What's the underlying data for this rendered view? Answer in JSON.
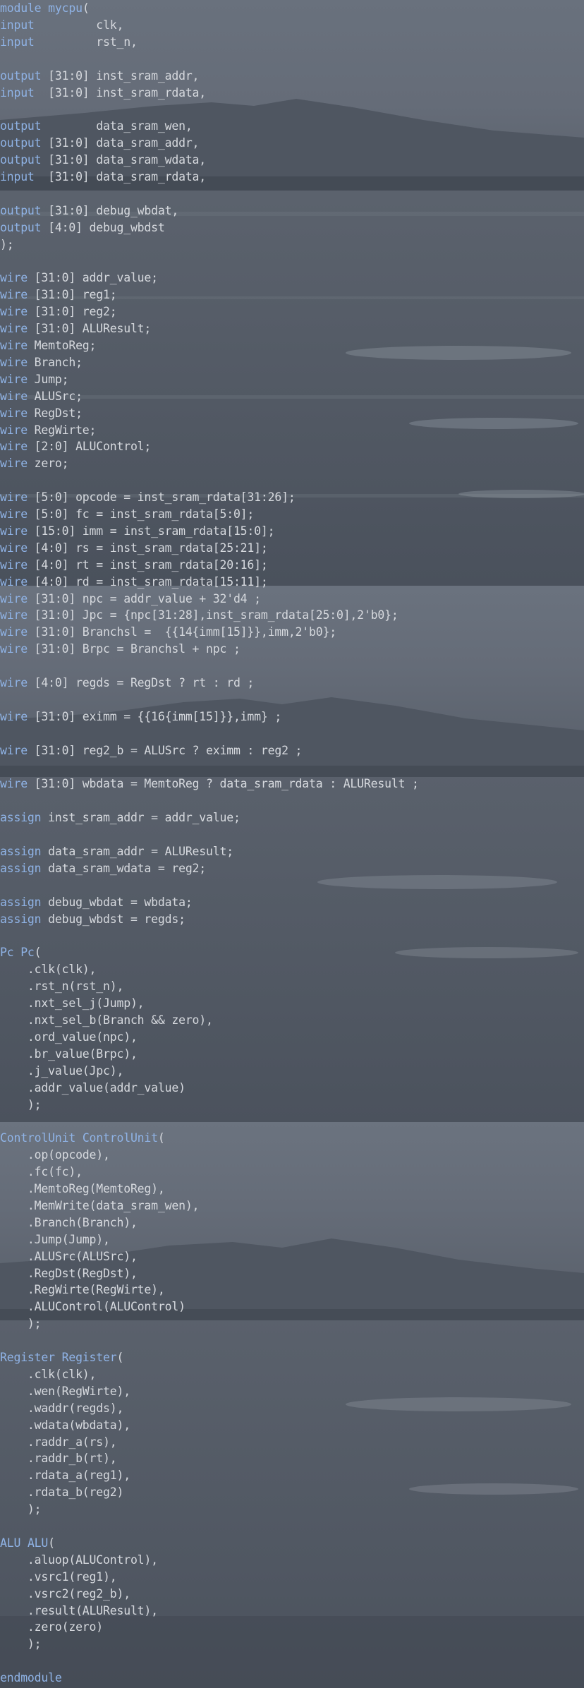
{
  "editor": {
    "colors": {
      "keyword": "#8fb3e6",
      "text": "#d6d9de",
      "background": "#59606c"
    },
    "lines": [
      {
        "row": 0,
        "tokens": [
          {
            "t": "kw",
            "v": "module"
          },
          {
            "t": "txt",
            "v": " "
          },
          {
            "t": "kw",
            "v": "mycpu"
          },
          {
            "t": "txt",
            "v": "("
          }
        ]
      },
      {
        "row": 1,
        "tokens": [
          {
            "t": "kw",
            "v": "input"
          },
          {
            "t": "txt",
            "v": "         clk,"
          }
        ]
      },
      {
        "row": 2,
        "tokens": [
          {
            "t": "kw",
            "v": "input"
          },
          {
            "t": "txt",
            "v": "         rst_n,"
          }
        ]
      },
      {
        "row": 4,
        "tokens": [
          {
            "t": "kw",
            "v": "output"
          },
          {
            "t": "txt",
            "v": " [31:0] inst_sram_addr,"
          }
        ]
      },
      {
        "row": 5,
        "tokens": [
          {
            "t": "kw",
            "v": "input"
          },
          {
            "t": "txt",
            "v": "  [31:0] inst_sram_rdata,"
          }
        ]
      },
      {
        "row": 7,
        "tokens": [
          {
            "t": "kw",
            "v": "output"
          },
          {
            "t": "txt",
            "v": "        data_sram_wen,"
          }
        ]
      },
      {
        "row": 8,
        "tokens": [
          {
            "t": "kw",
            "v": "output"
          },
          {
            "t": "txt",
            "v": " [31:0] data_sram_addr,"
          }
        ]
      },
      {
        "row": 9,
        "tokens": [
          {
            "t": "kw",
            "v": "output"
          },
          {
            "t": "txt",
            "v": " [31:0] data_sram_wdata,"
          }
        ]
      },
      {
        "row": 10,
        "tokens": [
          {
            "t": "kw",
            "v": "input"
          },
          {
            "t": "txt",
            "v": "  [31:0] data_sram_rdata,"
          }
        ]
      },
      {
        "row": 12,
        "tokens": [
          {
            "t": "kw",
            "v": "output"
          },
          {
            "t": "txt",
            "v": " [31:0] debug_wbdat,"
          }
        ]
      },
      {
        "row": 13,
        "tokens": [
          {
            "t": "kw",
            "v": "output"
          },
          {
            "t": "txt",
            "v": " [4:0] debug_wbdst"
          }
        ]
      },
      {
        "row": 14,
        "tokens": [
          {
            "t": "txt",
            "v": ");"
          }
        ]
      },
      {
        "row": 16,
        "tokens": [
          {
            "t": "kw",
            "v": "wire"
          },
          {
            "t": "txt",
            "v": " [31:0] addr_value;"
          }
        ]
      },
      {
        "row": 17,
        "tokens": [
          {
            "t": "kw",
            "v": "wire"
          },
          {
            "t": "txt",
            "v": " [31:0] reg1;"
          }
        ]
      },
      {
        "row": 18,
        "tokens": [
          {
            "t": "kw",
            "v": "wire"
          },
          {
            "t": "txt",
            "v": " [31:0] reg2;"
          }
        ]
      },
      {
        "row": 19,
        "tokens": [
          {
            "t": "kw",
            "v": "wire"
          },
          {
            "t": "txt",
            "v": " [31:0] ALUResult;"
          }
        ]
      },
      {
        "row": 20,
        "tokens": [
          {
            "t": "kw",
            "v": "wire"
          },
          {
            "t": "txt",
            "v": " MemtoReg;"
          }
        ]
      },
      {
        "row": 21,
        "tokens": [
          {
            "t": "kw",
            "v": "wire"
          },
          {
            "t": "txt",
            "v": " Branch;"
          }
        ]
      },
      {
        "row": 22,
        "tokens": [
          {
            "t": "kw",
            "v": "wire"
          },
          {
            "t": "txt",
            "v": " Jump;"
          }
        ]
      },
      {
        "row": 23,
        "tokens": [
          {
            "t": "kw",
            "v": "wire"
          },
          {
            "t": "txt",
            "v": " ALUSrc;"
          }
        ]
      },
      {
        "row": 24,
        "tokens": [
          {
            "t": "kw",
            "v": "wire"
          },
          {
            "t": "txt",
            "v": " RegDst;"
          }
        ]
      },
      {
        "row": 25,
        "tokens": [
          {
            "t": "kw",
            "v": "wire"
          },
          {
            "t": "txt",
            "v": " RegWirte;"
          }
        ]
      },
      {
        "row": 26,
        "tokens": [
          {
            "t": "kw",
            "v": "wire"
          },
          {
            "t": "txt",
            "v": " [2:0] ALUControl;"
          }
        ]
      },
      {
        "row": 27,
        "tokens": [
          {
            "t": "kw",
            "v": "wire"
          },
          {
            "t": "txt",
            "v": " zero;"
          }
        ]
      },
      {
        "row": 29,
        "tokens": [
          {
            "t": "kw",
            "v": "wire"
          },
          {
            "t": "txt",
            "v": " [5:0] opcode = inst_sram_rdata[31:26];"
          }
        ]
      },
      {
        "row": 30,
        "tokens": [
          {
            "t": "kw",
            "v": "wire"
          },
          {
            "t": "txt",
            "v": " [5:0] fc = inst_sram_rdata[5:0];"
          }
        ]
      },
      {
        "row": 31,
        "tokens": [
          {
            "t": "kw",
            "v": "wire"
          },
          {
            "t": "txt",
            "v": " [15:0] imm = inst_sram_rdata[15:0];"
          }
        ]
      },
      {
        "row": 32,
        "tokens": [
          {
            "t": "kw",
            "v": "wire"
          },
          {
            "t": "txt",
            "v": " [4:0] rs = inst_sram_rdata[25:21];"
          }
        ]
      },
      {
        "row": 33,
        "tokens": [
          {
            "t": "kw",
            "v": "wire"
          },
          {
            "t": "txt",
            "v": " [4:0] rt = inst_sram_rdata[20:16];"
          }
        ]
      },
      {
        "row": 34,
        "tokens": [
          {
            "t": "kw",
            "v": "wire"
          },
          {
            "t": "txt",
            "v": " [4:0] rd = inst_sram_rdata[15:11];"
          }
        ]
      },
      {
        "row": 35,
        "tokens": [
          {
            "t": "kw",
            "v": "wire"
          },
          {
            "t": "txt",
            "v": " [31:0] npc = addr_value + 32'd4 ;"
          }
        ]
      },
      {
        "row": 36,
        "tokens": [
          {
            "t": "kw",
            "v": "wire"
          },
          {
            "t": "txt",
            "v": " [31:0] Jpc = {npc[31:28],inst_sram_rdata[25:0],2'b0};"
          }
        ]
      },
      {
        "row": 37,
        "tokens": [
          {
            "t": "kw",
            "v": "wire"
          },
          {
            "t": "txt",
            "v": " [31:0] Branchsl =  {{14{imm[15]}},imm,2'b0};"
          }
        ]
      },
      {
        "row": 38,
        "tokens": [
          {
            "t": "kw",
            "v": "wire"
          },
          {
            "t": "txt",
            "v": " [31:0] Brpc = Branchsl + npc ;"
          }
        ]
      },
      {
        "row": 40,
        "tokens": [
          {
            "t": "kw",
            "v": "wire"
          },
          {
            "t": "txt",
            "v": " [4:0] regds = RegDst ? rt : rd ;"
          }
        ]
      },
      {
        "row": 42,
        "tokens": [
          {
            "t": "kw",
            "v": "wire"
          },
          {
            "t": "txt",
            "v": " [31:0] eximm = {{16{imm[15]}},imm} ;"
          }
        ]
      },
      {
        "row": 44,
        "tokens": [
          {
            "t": "kw",
            "v": "wire"
          },
          {
            "t": "txt",
            "v": " [31:0] reg2_b = ALUSrc ? eximm : reg2 ;"
          }
        ]
      },
      {
        "row": 46,
        "tokens": [
          {
            "t": "kw",
            "v": "wire"
          },
          {
            "t": "txt",
            "v": " [31:0] wbdata = MemtoReg ? data_sram_rdata : ALUResult ;"
          }
        ]
      },
      {
        "row": 48,
        "tokens": [
          {
            "t": "kw",
            "v": "assign"
          },
          {
            "t": "txt",
            "v": " inst_sram_addr = addr_value;"
          }
        ]
      },
      {
        "row": 50,
        "tokens": [
          {
            "t": "kw",
            "v": "assign"
          },
          {
            "t": "txt",
            "v": " data_sram_addr = ALUResult;"
          }
        ]
      },
      {
        "row": 51,
        "tokens": [
          {
            "t": "kw",
            "v": "assign"
          },
          {
            "t": "txt",
            "v": " data_sram_wdata = reg2;"
          }
        ]
      },
      {
        "row": 53,
        "tokens": [
          {
            "t": "kw",
            "v": "assign"
          },
          {
            "t": "txt",
            "v": " debug_wbdat = wbdata;"
          }
        ]
      },
      {
        "row": 54,
        "tokens": [
          {
            "t": "kw",
            "v": "assign"
          },
          {
            "t": "txt",
            "v": " debug_wbdst = regds;"
          }
        ]
      },
      {
        "row": 56,
        "tokens": [
          {
            "t": "kw",
            "v": "Pc"
          },
          {
            "t": "txt",
            "v": " "
          },
          {
            "t": "kw",
            "v": "Pc"
          },
          {
            "t": "txt",
            "v": "("
          }
        ]
      },
      {
        "row": 57,
        "tokens": [
          {
            "t": "txt",
            "v": "    .clk(clk),"
          }
        ]
      },
      {
        "row": 58,
        "tokens": [
          {
            "t": "txt",
            "v": "    .rst_n(rst_n),"
          }
        ]
      },
      {
        "row": 59,
        "tokens": [
          {
            "t": "txt",
            "v": "    .nxt_sel_j(Jump),"
          }
        ]
      },
      {
        "row": 60,
        "tokens": [
          {
            "t": "txt",
            "v": "    .nxt_sel_b(Branch && zero),"
          }
        ]
      },
      {
        "row": 61,
        "tokens": [
          {
            "t": "txt",
            "v": "    .ord_value(npc),"
          }
        ]
      },
      {
        "row": 62,
        "tokens": [
          {
            "t": "txt",
            "v": "    .br_value(Brpc),"
          }
        ]
      },
      {
        "row": 63,
        "tokens": [
          {
            "t": "txt",
            "v": "    .j_value(Jpc),"
          }
        ]
      },
      {
        "row": 64,
        "tokens": [
          {
            "t": "txt",
            "v": "    .addr_value(addr_value)"
          }
        ]
      },
      {
        "row": 65,
        "tokens": [
          {
            "t": "txt",
            "v": "    );"
          }
        ]
      },
      {
        "row": 67,
        "tokens": [
          {
            "t": "kw",
            "v": "ControlUnit"
          },
          {
            "t": "txt",
            "v": " "
          },
          {
            "t": "kw",
            "v": "ControlUnit"
          },
          {
            "t": "txt",
            "v": "("
          }
        ]
      },
      {
        "row": 68,
        "tokens": [
          {
            "t": "txt",
            "v": "    .op(opcode),"
          }
        ]
      },
      {
        "row": 69,
        "tokens": [
          {
            "t": "txt",
            "v": "    .fc(fc),"
          }
        ]
      },
      {
        "row": 70,
        "tokens": [
          {
            "t": "txt",
            "v": "    .MemtoReg(MemtoReg),"
          }
        ]
      },
      {
        "row": 71,
        "tokens": [
          {
            "t": "txt",
            "v": "    .MemWrite(data_sram_wen),"
          }
        ]
      },
      {
        "row": 72,
        "tokens": [
          {
            "t": "txt",
            "v": "    .Branch(Branch),"
          }
        ]
      },
      {
        "row": 73,
        "tokens": [
          {
            "t": "txt",
            "v": "    .Jump(Jump),"
          }
        ]
      },
      {
        "row": 74,
        "tokens": [
          {
            "t": "txt",
            "v": "    .ALUSrc(ALUSrc),"
          }
        ]
      },
      {
        "row": 75,
        "tokens": [
          {
            "t": "txt",
            "v": "    .RegDst(RegDst),"
          }
        ]
      },
      {
        "row": 76,
        "tokens": [
          {
            "t": "txt",
            "v": "    .RegWirte(RegWirte),"
          }
        ]
      },
      {
        "row": 77,
        "tokens": [
          {
            "t": "txt",
            "v": "    .ALUControl(ALUControl)"
          }
        ]
      },
      {
        "row": 78,
        "tokens": [
          {
            "t": "txt",
            "v": "    );"
          }
        ]
      },
      {
        "row": 80,
        "tokens": [
          {
            "t": "kw",
            "v": "Register"
          },
          {
            "t": "txt",
            "v": " "
          },
          {
            "t": "kw",
            "v": "Register"
          },
          {
            "t": "txt",
            "v": "("
          }
        ]
      },
      {
        "row": 81,
        "tokens": [
          {
            "t": "txt",
            "v": "    .clk(clk),"
          }
        ]
      },
      {
        "row": 82,
        "tokens": [
          {
            "t": "txt",
            "v": "    .wen(RegWirte),"
          }
        ]
      },
      {
        "row": 83,
        "tokens": [
          {
            "t": "txt",
            "v": "    .waddr(regds),"
          }
        ]
      },
      {
        "row": 84,
        "tokens": [
          {
            "t": "txt",
            "v": "    .wdata(wbdata),"
          }
        ]
      },
      {
        "row": 85,
        "tokens": [
          {
            "t": "txt",
            "v": "    .raddr_a(rs),"
          }
        ]
      },
      {
        "row": 86,
        "tokens": [
          {
            "t": "txt",
            "v": "    .raddr_b(rt),"
          }
        ]
      },
      {
        "row": 87,
        "tokens": [
          {
            "t": "txt",
            "v": "    .rdata_a(reg1),"
          }
        ]
      },
      {
        "row": 88,
        "tokens": [
          {
            "t": "txt",
            "v": "    .rdata_b(reg2)"
          }
        ]
      },
      {
        "row": 89,
        "tokens": [
          {
            "t": "txt",
            "v": "    );"
          }
        ]
      },
      {
        "row": 91,
        "tokens": [
          {
            "t": "kw",
            "v": "ALU"
          },
          {
            "t": "txt",
            "v": " "
          },
          {
            "t": "kw",
            "v": "ALU"
          },
          {
            "t": "txt",
            "v": "("
          }
        ]
      },
      {
        "row": 92,
        "tokens": [
          {
            "t": "txt",
            "v": "    .aluop(ALUControl),"
          }
        ]
      },
      {
        "row": 93,
        "tokens": [
          {
            "t": "txt",
            "v": "    .vsrc1(reg1),"
          }
        ]
      },
      {
        "row": 94,
        "tokens": [
          {
            "t": "txt",
            "v": "    .vsrc2(reg2_b),"
          }
        ]
      },
      {
        "row": 95,
        "tokens": [
          {
            "t": "txt",
            "v": "    .result(ALUResult),"
          }
        ]
      },
      {
        "row": 96,
        "tokens": [
          {
            "t": "txt",
            "v": "    .zero(zero)"
          }
        ]
      },
      {
        "row": 97,
        "tokens": [
          {
            "t": "txt",
            "v": "    );"
          }
        ]
      },
      {
        "row": 99,
        "tokens": [
          {
            "t": "kw",
            "v": "endmodule"
          }
        ]
      }
    ]
  }
}
